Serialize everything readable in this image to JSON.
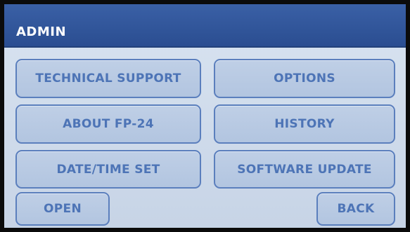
{
  "header": {
    "title": "ADMIN"
  },
  "menu": {
    "technical_support": "TECHNICAL SUPPORT",
    "options": "OPTIONS",
    "about": "ABOUT FP-24",
    "history": "HISTORY",
    "date_time_set": "DATE/TIME SET",
    "software_update": "SOFTWARE UPDATE"
  },
  "footer": {
    "open": "OPEN",
    "back": "BACK"
  },
  "colors": {
    "title_bar": "#2f5499",
    "button_fill": "#b9cbe4",
    "button_text": "#4d74b6",
    "screen_bg": "#d3deed"
  }
}
